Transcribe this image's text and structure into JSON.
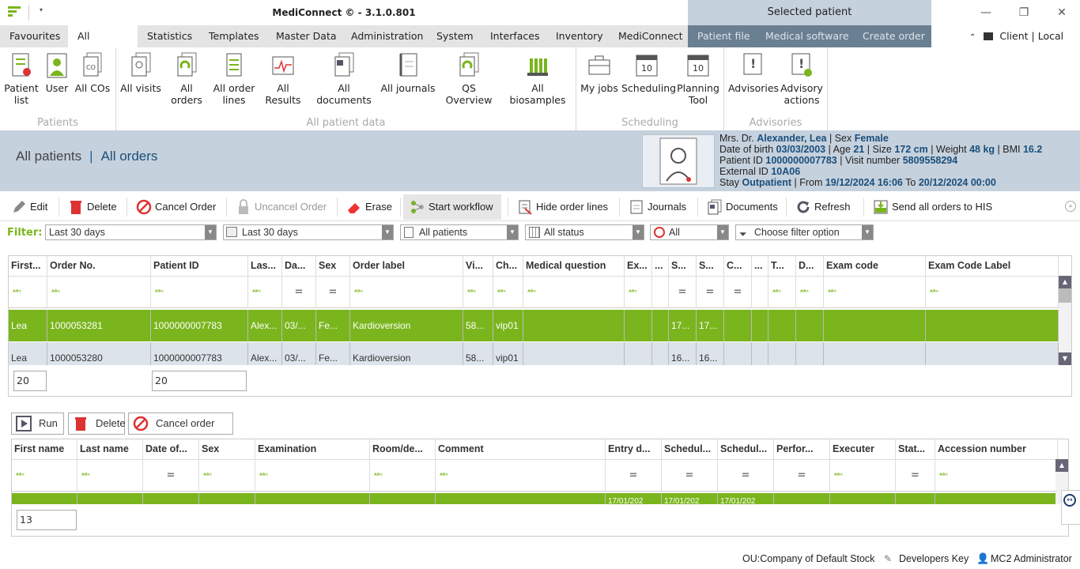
{
  "app": {
    "title": "MediConnect © - 3.1.0.801",
    "selected_patient_header": "Selected patient",
    "client_info": "Client | Local DB"
  },
  "menu": {
    "tabs": [
      "Favourites",
      "All patients",
      "Statistics",
      "Templates",
      "Master Data",
      "Administration",
      "System",
      "Interfaces",
      "Inventory",
      "MediConnect"
    ],
    "patient_tabs": [
      "Patient file",
      "Medical software",
      "Create order"
    ]
  },
  "ribbon": {
    "patients": {
      "label": "Patients",
      "buttons": [
        "Patient list",
        "User",
        "All COs"
      ]
    },
    "all_patient_data": {
      "label": "All patient data",
      "buttons": [
        "All visits",
        "All orders",
        "All order lines",
        "All Results",
        "All documents",
        "All journals",
        "QS Overview",
        "All biosamples"
      ]
    },
    "scheduling": {
      "label": "Scheduling",
      "buttons": [
        "My jobs",
        "Scheduling",
        "Planning Tool"
      ]
    },
    "advisories": {
      "label": "Advisories",
      "buttons": [
        "Advisories",
        "Advisory actions"
      ]
    }
  },
  "breadcrumb": {
    "parent": "All patients",
    "sep": "|",
    "current": "All orders"
  },
  "patient": {
    "line1_prefix": "Mrs. Dr.",
    "name": "Alexander, Lea",
    "sex_label": "| Sex",
    "sex": "Female",
    "dob_label": "Date of birth",
    "dob": "03/03/2003",
    "age_label": "| Age",
    "age": "21",
    "size_label": "| Size",
    "size": "172 cm",
    "weight_label": "| Weight",
    "weight": "48 kg",
    "bmi_label": "| BMI",
    "bmi": "16.2",
    "pid_label": "Patient ID",
    "pid": "1000000007783",
    "visit_label": "| Visit number",
    "visit": "5809558294",
    "ext_label": "External ID",
    "ext": "10A06",
    "stay_label": "Stay",
    "stay": "Outpatient",
    "from_label": "| From",
    "from": "19/12/2024 16:06",
    "to_label": "To",
    "to": "20/12/2024 00:00"
  },
  "toolbar": [
    "Edit",
    "Delete",
    "Cancel Order",
    "Uncancel Order",
    "Erase",
    "Start workflow",
    "Hide order lines",
    "Journals",
    "Documents",
    "Refresh",
    "Send all orders to HIS"
  ],
  "filter": {
    "label": "Filter:",
    "options": [
      "Last 30 days",
      "Last 30 days",
      "All patients",
      "All status",
      "All",
      "Choose filter option"
    ]
  },
  "orders": {
    "headers": [
      "First...",
      "Order No.",
      "Patient ID",
      "Las...",
      "Da...",
      "Sex",
      "Order label",
      "Vi...",
      "Ch...",
      "Medical question",
      "Ex...",
      "...",
      "S...",
      "S...",
      "C...",
      "...",
      "T...",
      "D...",
      "Exam code",
      "Exam Code Label"
    ],
    "rows": [
      [
        "Lea",
        "1000053281",
        "1000000007783",
        "Alex...",
        "03/...",
        "Fe...",
        "Kardioversion",
        "58...",
        "vip01",
        "",
        "",
        "",
        "17...",
        "17...",
        "",
        "",
        "",
        "",
        "",
        ""
      ],
      [
        "Lea",
        "1000053280",
        "1000000007783",
        "Alex...",
        "03/...",
        "Fe...",
        "Kardioversion",
        "58...",
        "vip01",
        "",
        "",
        "",
        "16...",
        "16...",
        "",
        "",
        "",
        "",
        "",
        ""
      ]
    ],
    "count1": "20",
    "count2": "20"
  },
  "lines_toolbar": [
    "Run",
    "Delete",
    "Cancel order line"
  ],
  "order_lines": {
    "headers": [
      "First name",
      "Last name",
      "Date of...",
      "Sex",
      "Examination",
      "Room/de...",
      "Comment",
      "Entry d...",
      "Schedul...",
      "Schedul...",
      "Perfor...",
      "Executer",
      "Stat...",
      "Accession number"
    ],
    "row": [
      "",
      "",
      "",
      "",
      "",
      "",
      "",
      "17/01/202",
      "17/01/202",
      "17/01/202",
      "",
      "",
      "",
      ""
    ],
    "count": "13"
  },
  "status": {
    "ou": "OU:Company of Default Stock",
    "key": "Developers Key",
    "user": "MC2 Administrator"
  },
  "colors": {
    "accent": "#7ab51d",
    "header_bg": "#c5d1dd",
    "dark_tab": "#6b7f93"
  }
}
